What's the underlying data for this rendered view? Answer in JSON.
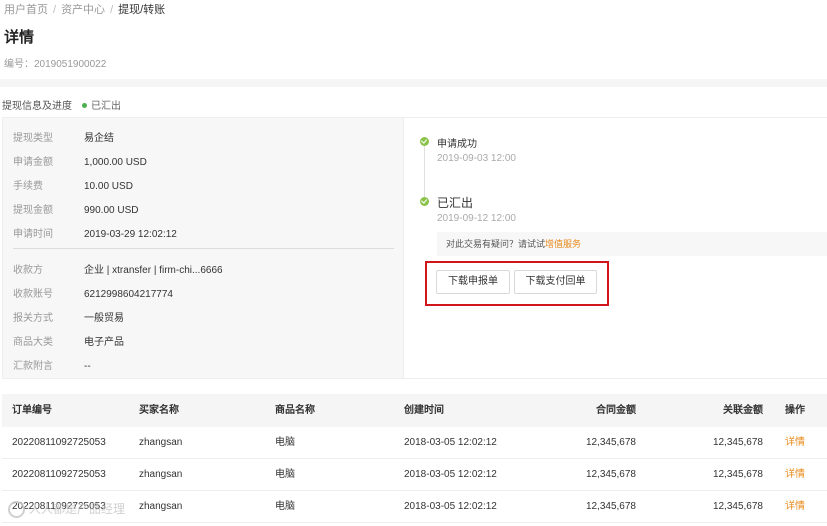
{
  "breadcrumb": {
    "items": [
      "用户首页",
      "资产中心"
    ],
    "current": "提现/转账",
    "separator": "/"
  },
  "page": {
    "title": "详情",
    "order_label": "编号：",
    "order_number": "2019051900022"
  },
  "progress": {
    "label": "提现信息及进度",
    "status": "已汇出"
  },
  "details": {
    "group1": [
      {
        "key": "提现类型",
        "value": "易企结"
      },
      {
        "key": "申请金额",
        "value": "1,000.00 USD"
      },
      {
        "key": "手续费",
        "value": "10.00 USD"
      },
      {
        "key": "提现金额",
        "value": "990.00 USD"
      },
      {
        "key": "申请时间",
        "value": "2019-03-29 12:02:12"
      }
    ],
    "group2": [
      {
        "key": "收款方",
        "value": "企业 | xtransfer | firm-chi...6666"
      },
      {
        "key": "收款账号",
        "value": "6212998604217774"
      },
      {
        "key": "报关方式",
        "value": "一般贸易"
      },
      {
        "key": "商品大类",
        "value": "电子产品"
      },
      {
        "key": "汇款附言",
        "value": "--"
      }
    ]
  },
  "timeline": [
    {
      "title": "申请成功",
      "time": "2019-09-03 12:00"
    },
    {
      "title": "已汇出",
      "time": "2019-09-12 12:00"
    }
  ],
  "help": {
    "text": "对此交易有疑问？请试试",
    "link": "增值服务"
  },
  "buttons": {
    "download_report": "下载申报单",
    "download_receipt": "下载支付回单"
  },
  "table": {
    "headers": [
      "订单编号",
      "买家名称",
      "商品名称",
      "创建时间",
      "合同金额",
      "关联金额",
      "操作"
    ],
    "rows": [
      [
        "20220811092725053",
        "zhangsan",
        "电脑",
        "2018-03-05 12:02:12",
        "12,345,678",
        "12,345,678",
        "详情"
      ],
      [
        "20220811092725053",
        "zhangsan",
        "电脑",
        "2018-03-05 12:02:12",
        "12,345,678",
        "12,345,678",
        "详情"
      ],
      [
        "20220811092725053",
        "zhangsan",
        "电脑",
        "2018-03-05 12:02:12",
        "12,345,678",
        "12,345,678",
        "详情"
      ]
    ]
  },
  "watermark": {
    "text": "人人都是产品经理"
  },
  "colors": {
    "accent": "#e8891b",
    "success": "#8bc34a",
    "highlight": "#d0161b"
  }
}
